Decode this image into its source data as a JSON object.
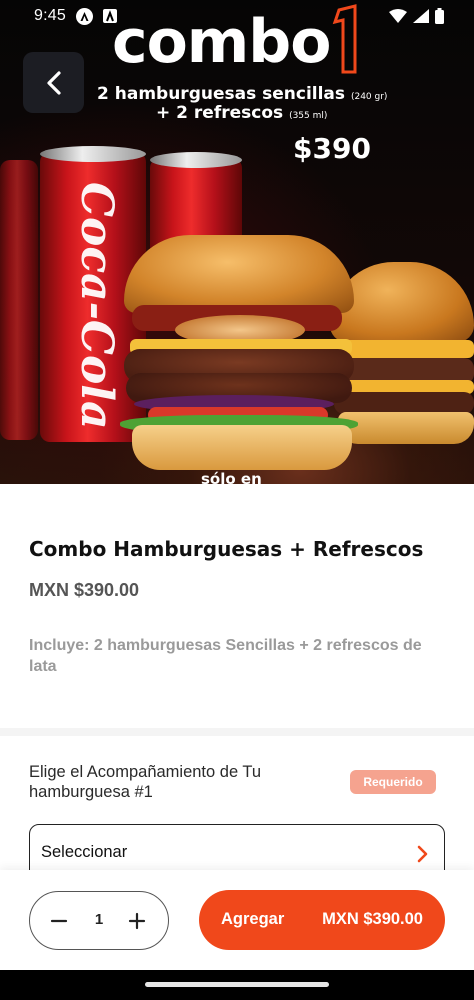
{
  "status_bar": {
    "time": "9:45",
    "icons": [
      "app-a-icon",
      "app-b-icon",
      "wifi-icon",
      "signal-icon",
      "battery-icon"
    ]
  },
  "hero": {
    "promo_title": "combo",
    "promo_number": "1",
    "promo_line1": "2 hamburguesas sencillas",
    "promo_line1_unit": "(240 gr)",
    "promo_line2": "+ 2 refrescos",
    "promo_line2_unit": "(355 ml)",
    "promo_price": "$390",
    "promo_footer": "sólo en",
    "can_brand": "Coca-Cola",
    "accent": "#f0481b"
  },
  "product": {
    "title": "Combo Hamburguesas + Refrescos",
    "price": "MXN $390.00",
    "description": "Incluye: 2 hamburguesas Sencillas + 2 refrescos de lata"
  },
  "option": {
    "label": "Elige el Acompañamiento de Tu hamburguesa #1",
    "required_badge": "Requerido",
    "select_placeholder": "Seleccionar"
  },
  "cart": {
    "quantity": "1",
    "add_label": "Agregar",
    "add_price": "MXN $390.00"
  },
  "colors": {
    "primary": "#f0481b",
    "badge": "#f5a38f"
  }
}
